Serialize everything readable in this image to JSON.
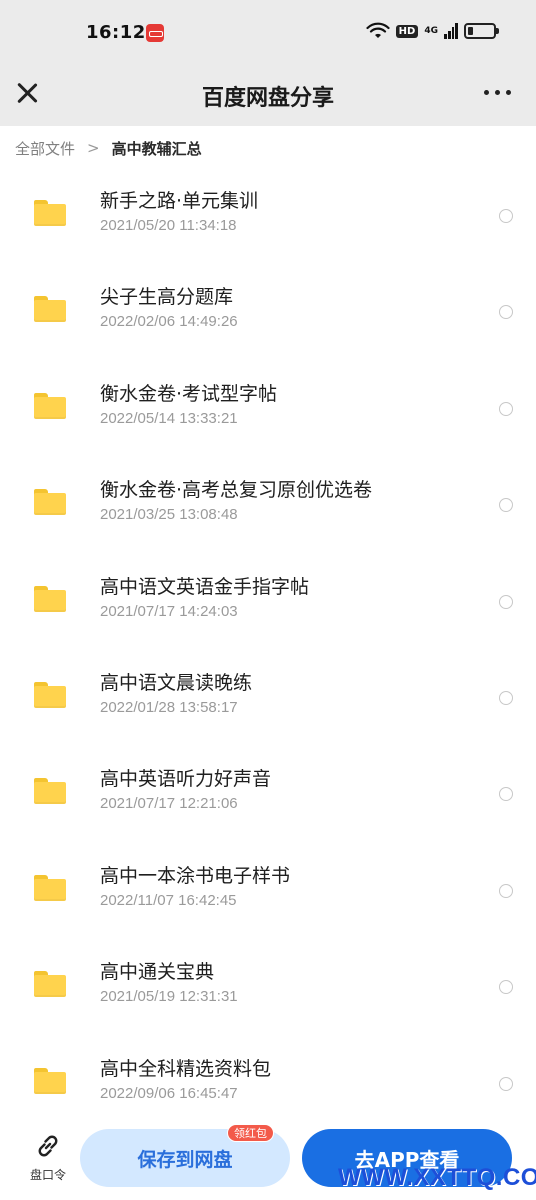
{
  "status_bar": {
    "time": "16:12",
    "hd": "HD",
    "network": "4G",
    "icons": [
      "red-app-icon",
      "wifi-icon",
      "signal-icon",
      "battery-icon"
    ]
  },
  "header": {
    "title": "百度网盘分享",
    "close_icon": "close-icon",
    "more_icon": "more-icon"
  },
  "breadcrumb": {
    "root": "全部文件",
    "separator": ">",
    "current": "高中教辅汇总"
  },
  "files": [
    {
      "name": "新手之路·单元集训",
      "time": "2021/05/20 11:34:18"
    },
    {
      "name": "尖子生高分题库",
      "time": "2022/02/06 14:49:26"
    },
    {
      "name": "衡水金卷·考试型字帖",
      "time": "2022/05/14 13:33:21"
    },
    {
      "name": "衡水金卷·高考总复习原创优选卷",
      "time": "2021/03/25 13:08:48"
    },
    {
      "name": "高中语文英语金手指字帖",
      "time": "2021/07/17 14:24:03"
    },
    {
      "name": "高中语文晨读晚练",
      "time": "2022/01/28 13:58:17"
    },
    {
      "name": "高中英语听力好声音",
      "time": "2021/07/17 12:21:06"
    },
    {
      "name": "高中一本涂书电子样书",
      "time": "2022/11/07 16:42:45"
    },
    {
      "name": "高中通关宝典",
      "time": "2021/05/19 12:31:31"
    },
    {
      "name": "高中全科精选资料包",
      "time": "2022/09/06 16:45:47"
    }
  ],
  "bottom_bar": {
    "link_label": "盘口令",
    "save_label": "保存到网盘",
    "badge": "领红包",
    "open_label": "去APP查看"
  },
  "watermark": "WWW.XXTTQ.COM",
  "colors": {
    "accent": "#1a6fe3",
    "folder": "#ffd34d",
    "header_bg": "#ebebeb",
    "badge": "#f35a4a"
  }
}
